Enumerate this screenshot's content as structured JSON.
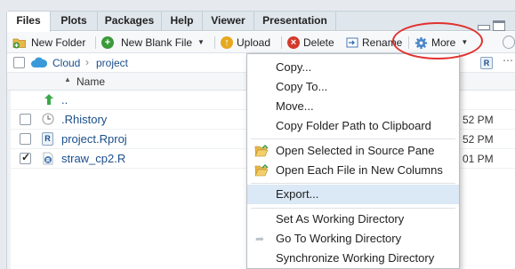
{
  "tabs": [
    "Files",
    "Plots",
    "Packages",
    "Help",
    "Viewer",
    "Presentation"
  ],
  "toolbar": {
    "new_folder": "New Folder",
    "new_blank_file": "New Blank File",
    "upload": "Upload",
    "delete": "Delete",
    "rename": "Rename",
    "more": "More"
  },
  "path": {
    "root": "Cloud",
    "separator": "›",
    "folder": "project"
  },
  "columns": {
    "name": "Name"
  },
  "files": [
    {
      "name": "..",
      "time": ""
    },
    {
      "name": ".Rhistory",
      "time": "52 PM"
    },
    {
      "name": "project.Rproj",
      "time": "52 PM"
    },
    {
      "name": "straw_cp2.R",
      "time": "01 PM"
    }
  ],
  "menu": {
    "copy": "Copy...",
    "copy_to": "Copy To...",
    "move": "Move...",
    "copy_path": "Copy Folder Path to Clipboard",
    "open_source": "Open Selected in Source Pane",
    "open_columns": "Open Each File in New Columns",
    "export": "Export...",
    "set_wd": "Set As Working Directory",
    "goto_wd": "Go To Working Directory",
    "sync_wd": "Synchronize Working Directory"
  },
  "icons": {
    "new_folder": "folder-plus-icon",
    "new_file": "plus-circle-icon",
    "upload": "upload-icon",
    "delete": "delete-icon",
    "rename": "rename-icon",
    "more": "gear-icon",
    "cloud": "cloud-icon",
    "up": "up-arrow-icon",
    "open_folder": "open-folder-icon",
    "goto": "arrow-right-icon"
  },
  "colors": {
    "accent": "#1a4e8a",
    "annotation": "#e0322e",
    "menu_highlight": "#dbe8f5"
  }
}
